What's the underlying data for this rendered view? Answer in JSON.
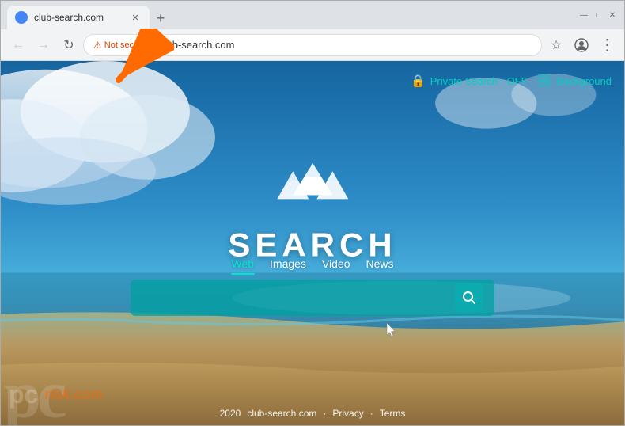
{
  "browser": {
    "tab": {
      "title": "club-search.com",
      "favicon": "🌐"
    },
    "newTab": "+",
    "window_controls": {
      "minimize": "—",
      "maximize": "□",
      "close": "✕"
    },
    "address_bar": {
      "back_btn": "←",
      "forward_btn": "→",
      "refresh_btn": "↻",
      "security_label": "Not secure",
      "url": "club-search.com",
      "bookmark_icon": "☆",
      "profile_icon": "👤",
      "menu_icon": "⋮"
    }
  },
  "page": {
    "top_right": {
      "private_search_label": "Private Search - OFF",
      "background_label": "Background"
    },
    "logo": {
      "search_text": "SEARCH"
    },
    "tabs": [
      {
        "label": "Web",
        "active": true
      },
      {
        "label": "Images",
        "active": false
      },
      {
        "label": "Video",
        "active": false
      },
      {
        "label": "News",
        "active": false
      }
    ],
    "search_placeholder": "",
    "footer": {
      "year": "2020",
      "site": "club-search.com",
      "privacy": "Privacy",
      "separator": "·",
      "terms": "Terms"
    }
  }
}
